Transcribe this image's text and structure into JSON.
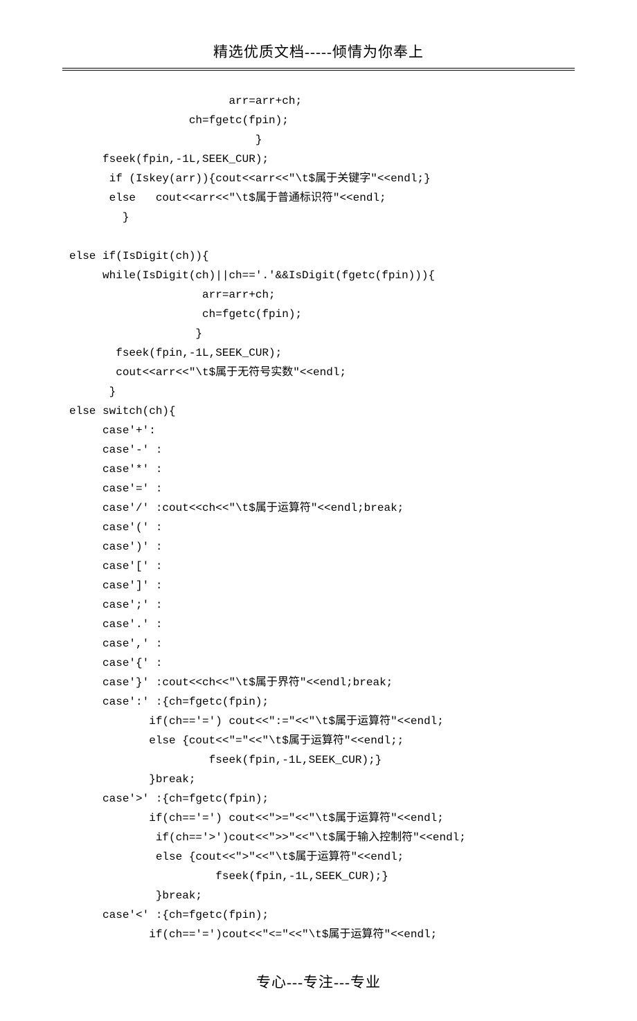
{
  "header": {
    "text": "精选优质文档-----倾情为你奉上"
  },
  "footer": {
    "text": "专心---专注---专业"
  },
  "code": {
    "lines": [
      "                        arr=arr+ch;",
      "                  ch=fgetc(fpin);",
      "                            }",
      "     fseek(fpin,-1L,SEEK_CUR);",
      "      if (Iskey(arr)){cout<<arr<<\"\\t$属于关键字\"<<endl;}",
      "      else   cout<<arr<<\"\\t$属于普通标识符\"<<endl;",
      "        }",
      "",
      "else if(IsDigit(ch)){",
      "     while(IsDigit(ch)||ch=='.'&&IsDigit(fgetc(fpin))){",
      "                    arr=arr+ch;",
      "                    ch=fgetc(fpin);",
      "                   }",
      "       fseek(fpin,-1L,SEEK_CUR);",
      "       cout<<arr<<\"\\t$属于无符号实数\"<<endl;",
      "      }",
      "else switch(ch){",
      "     case'+':",
      "     case'-' :",
      "     case'*' :",
      "     case'=' :",
      "     case'/' :cout<<ch<<\"\\t$属于运算符\"<<endl;break;",
      "     case'(' :",
      "     case')' :",
      "     case'[' :",
      "     case']' :",
      "     case';' :",
      "     case'.' :",
      "     case',' :",
      "     case'{' :",
      "     case'}' :cout<<ch<<\"\\t$属于界符\"<<endl;break;",
      "     case':' :{ch=fgetc(fpin);",
      "            if(ch=='=') cout<<\":=\"<<\"\\t$属于运算符\"<<endl;",
      "            else {cout<<\"=\"<<\"\\t$属于运算符\"<<endl;;",
      "                     fseek(fpin,-1L,SEEK_CUR);}",
      "            }break;",
      "     case'>' :{ch=fgetc(fpin);",
      "            if(ch=='=') cout<<\">=\"<<\"\\t$属于运算符\"<<endl;",
      "             if(ch=='>')cout<<\">>\"<<\"\\t$属于输入控制符\"<<endl;",
      "             else {cout<<\">\"<<\"\\t$属于运算符\"<<endl;",
      "                      fseek(fpin,-1L,SEEK_CUR);}",
      "             }break;",
      "     case'<' :{ch=fgetc(fpin);",
      "            if(ch=='=')cout<<\"<=\"<<\"\\t$属于运算符\"<<endl;"
    ]
  }
}
